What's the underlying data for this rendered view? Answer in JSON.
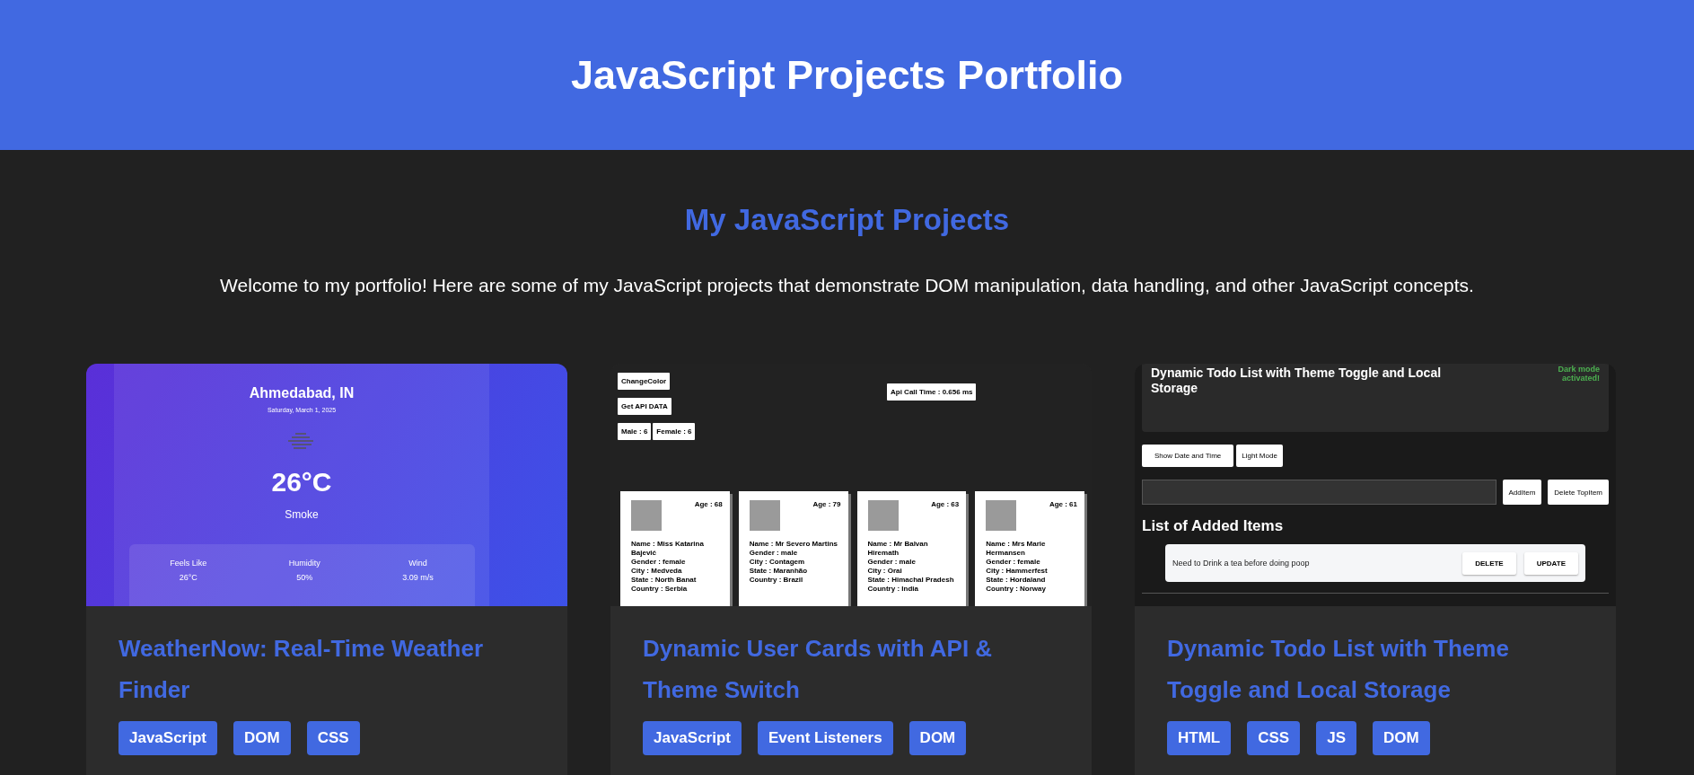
{
  "header": {
    "title": "JavaScript Projects Portfolio"
  },
  "intro": {
    "heading": "My JavaScript Projects",
    "text": "Welcome to my portfolio! Here are some of my JavaScript projects that demonstrate DOM manipulation, data handling, and other JavaScript concepts."
  },
  "projects": [
    {
      "title": "WeatherNow: Real-Time Weather Finder",
      "tags": [
        "JavaScript",
        "DOM",
        "CSS"
      ],
      "preview": {
        "kind": "weather",
        "city": "Ahmedabad, IN",
        "date": "Saturday, March 1, 2025",
        "temperature": "26°C",
        "condition": "Smoke",
        "stats": [
          {
            "label": "Feels Like",
            "value": "26°C"
          },
          {
            "label": "Humidity",
            "value": "50%"
          },
          {
            "label": "Wind",
            "value": "3.09 m/s"
          }
        ]
      }
    },
    {
      "title": "Dynamic User Cards with API & Theme Switch",
      "tags": [
        "JavaScript",
        "Event Listeners",
        "DOM"
      ],
      "preview": {
        "kind": "users",
        "buttons": [
          "ChangeColor",
          "Get API DATA"
        ],
        "counts": [
          "Male : 6",
          "Female : 6"
        ],
        "api_time": "Api Call Time : 0.656 ms",
        "users": [
          {
            "age": "Age : 68",
            "lines": [
              "Name : Miss Katarina Bajević",
              "Gender : female",
              "City : Medveda",
              "State : North Banat",
              "Country : Serbia"
            ]
          },
          {
            "age": "Age : 79",
            "lines": [
              "Name : Mr Severo Martins",
              "Gender : male",
              "City : Contagem",
              "State : Maranhão",
              "Country : Brazil"
            ]
          },
          {
            "age": "Age : 63",
            "lines": [
              "Name : Mr Balvan Hiremath",
              "Gender : male",
              "City : Orai",
              "State : Himachal Pradesh",
              "Country : India"
            ]
          },
          {
            "age": "Age : 61",
            "lines": [
              "Name : Mrs Marie Hermansen",
              "Gender : female",
              "City : Hammerfest",
              "State : Hordaland",
              "Country : Norway"
            ]
          }
        ]
      }
    },
    {
      "title": "Dynamic Todo List with Theme Toggle and Local Storage",
      "tags": [
        "HTML",
        "CSS",
        "JS",
        "DOM"
      ],
      "preview": {
        "kind": "todo",
        "title": "Dynamic Todo List with Theme Toggle and Local Storage",
        "status": "Dark mode activated!",
        "buttons": [
          "Show Date and Time",
          "Light Mode"
        ],
        "add_buttons": [
          "AddItem",
          "Delete TopItem"
        ],
        "list_heading": "List of Added Items",
        "items": [
          {
            "text": "Need to Drink a tea before doing poop",
            "actions": [
              "DELETE",
              "UPDATE"
            ]
          }
        ]
      }
    }
  ]
}
